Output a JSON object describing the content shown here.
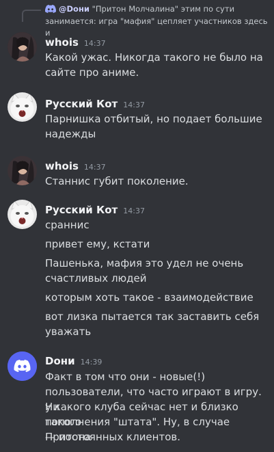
{
  "reply": {
    "mention": "@Dони",
    "text": " \"Притон Молчалина\" этим по сути",
    "continuation": "занимается: игра \"мафия\" цепляет участников здесь и"
  },
  "messages": [
    {
      "author": "whois",
      "time": "14:37",
      "avatar": "photo-avatar",
      "lines": [
        "Какой ужас. Никогда такого не было на",
        "сайте про аниме."
      ]
    },
    {
      "author": "Русский Кот",
      "time": "14:37",
      "avatar": "cat-avatar",
      "lines": [
        "Парнишка отбитый, но подает большие",
        "надежды"
      ]
    },
    {
      "author": "whois",
      "time": "14:37",
      "avatar": "photo-avatar",
      "lines": [
        "Станнис губит поколение."
      ]
    },
    {
      "author": "Русский Кот",
      "time": "14:37",
      "avatar": "cat-avatar",
      "lines": [
        "сраннис",
        "привет ему, кстати",
        "Пашенька, мафия это удел не очень",
        "счастливых людей",
        "которым хоть такое - взаимодействие",
        "вот лизка пытается так заставить себя",
        "уважать"
      ]
    },
    {
      "author": "Dони",
      "time": "14:39",
      "avatar": "discord-avatar",
      "lines": [
        "Факт в том что они - новые(!)",
        "пользователи, что часто играют в игру. Ни",
        "у какого клуба сейчас нет и близко такого",
        "пополнения \"штата\". Ну, в случае Притона",
        "— постоянных клиентов."
      ]
    }
  ],
  "colors": {
    "background": "#313338",
    "author": "#f2f3f5",
    "timestamp": "#949ba4",
    "discord_blurple": "#5865f2"
  }
}
